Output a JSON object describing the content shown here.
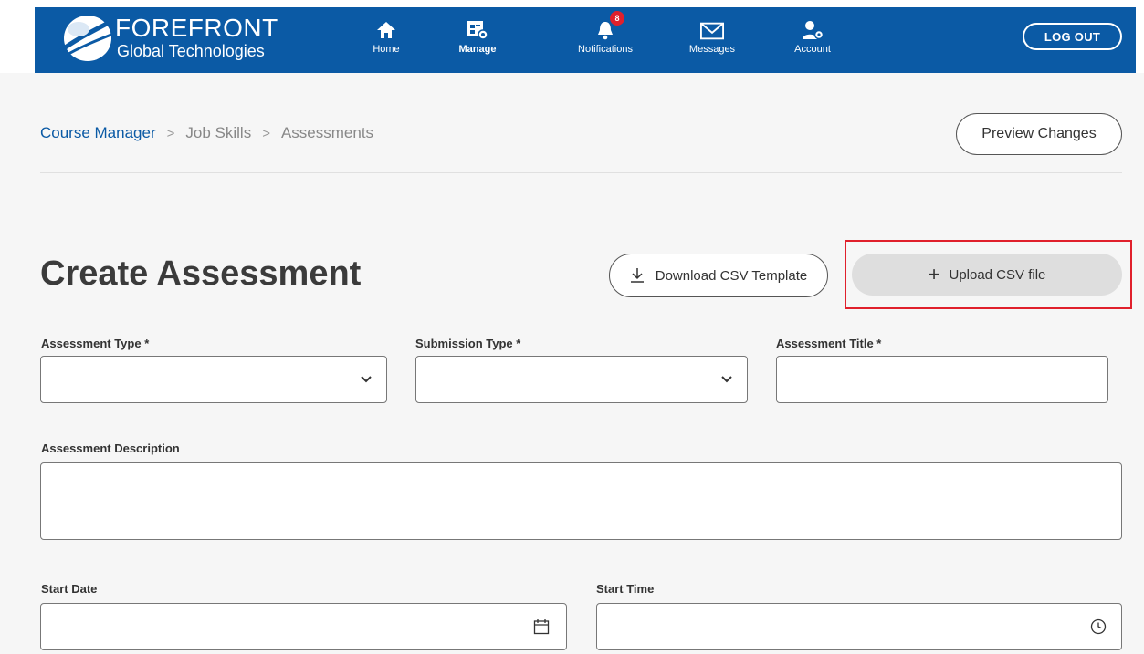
{
  "header": {
    "brand_name": "FOREFRONT",
    "brand_sub": "Global Technologies",
    "nav": [
      {
        "label": "Home",
        "icon": "home-icon",
        "active": false
      },
      {
        "label": "Manage",
        "icon": "manage-icon",
        "active": true
      },
      {
        "label": "Notifications",
        "icon": "bell-icon",
        "badge": "8",
        "active": false
      },
      {
        "label": "Messages",
        "icon": "envelope-icon",
        "active": false
      },
      {
        "label": "Account",
        "icon": "account-icon",
        "active": false
      }
    ],
    "logout_label": "LOG OUT",
    "colors": {
      "bar": "#0b5aa5",
      "badge": "#e0202c"
    }
  },
  "breadcrumb": {
    "items": [
      "Course Manager",
      "Job Skills",
      "Assessments"
    ],
    "separator": ">"
  },
  "preview_label": "Preview Changes",
  "page_title": "Create Assessment",
  "download_label": "Download CSV Template",
  "upload_label": "Upload CSV file",
  "upload_plus": "+",
  "highlight_color": "#e0202c",
  "form": {
    "assessment_type": {
      "label": "Assessment Type *",
      "value": ""
    },
    "submission_type": {
      "label": "Submission Type *",
      "value": ""
    },
    "assessment_title": {
      "label": "Assessment Title *",
      "value": ""
    },
    "assessment_description": {
      "label": "Assessment Description",
      "value": ""
    },
    "start_date": {
      "label": "Start Date",
      "value": ""
    },
    "start_time": {
      "label": "Start Time",
      "value": ""
    }
  }
}
